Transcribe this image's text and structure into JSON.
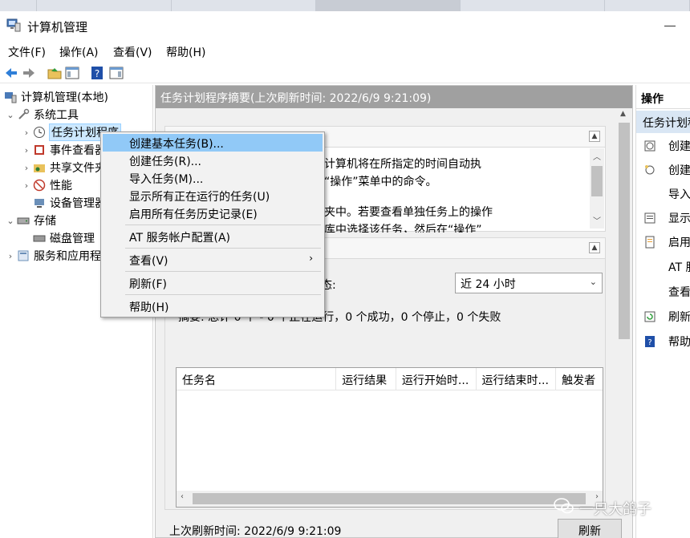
{
  "window": {
    "title": "计算机管理"
  },
  "menu": [
    "文件(F)",
    "操作(A)",
    "查看(V)",
    "帮助(H)"
  ],
  "tree": {
    "root": "计算机管理(本地)",
    "system_tools": "系统工具",
    "task_scheduler": "任务计划程序",
    "event_viewer": "事件查看器",
    "shared_folders": "共享文件夹",
    "performance": "性能",
    "device_manager": "设备管理器",
    "storage": "存储",
    "disk_management": "磁盘管理",
    "services": "服务和应用程序"
  },
  "center": {
    "header": "任务计划程序摘要(上次刷新时间: 2022/6/9 9:21:09)",
    "overview_line1": "来创建和管理计算机将在所指定的时间自动执",
    "overview_line2": "开始，请单击“操作”菜单中的命令。",
    "overview_line3": "程序库的文件夹中。若要查看单独任务上的操作",
    "overview_line4": "任务计划程序库中选择该任务，然后在“操作”",
    "status_label": "态:",
    "dropdown_value": "近 24 小时",
    "summary": "摘要: 总计 0 个 - 0 个正在运行，0 个成功，0 个停止，0 个失败",
    "columns": [
      "任务名",
      "运行结果",
      "运行开始时...",
      "运行结束时...",
      "触发者"
    ],
    "last_refresh": "上次刷新时间: 2022/6/9 9:21:09",
    "refresh_button": "刷新"
  },
  "actions": {
    "header": "操作",
    "subheader": "任务计划程序",
    "items": [
      "创建基本任务...",
      "创建任务...",
      "导入任务...",
      "显示所有正在运行的任务",
      "启用所有任务历史记录",
      "AT 服务帐户配置",
      "查看",
      "刷新",
      "帮助"
    ]
  },
  "context_menu": {
    "items": [
      "创建基本任务(B)...",
      "创建任务(R)...",
      "导入任务(M)...",
      "显示所有正在运行的任务(U)",
      "启用所有任务历史记录(E)",
      "AT 服务帐户配置(A)",
      "查看(V)",
      "刷新(F)",
      "帮助(H)"
    ]
  },
  "watermark": "一只大鸽子",
  "colors": {
    "highlight": "#91c9f7",
    "header_gray": "#a0a0a0",
    "selected_tree": "#cce8ff"
  }
}
